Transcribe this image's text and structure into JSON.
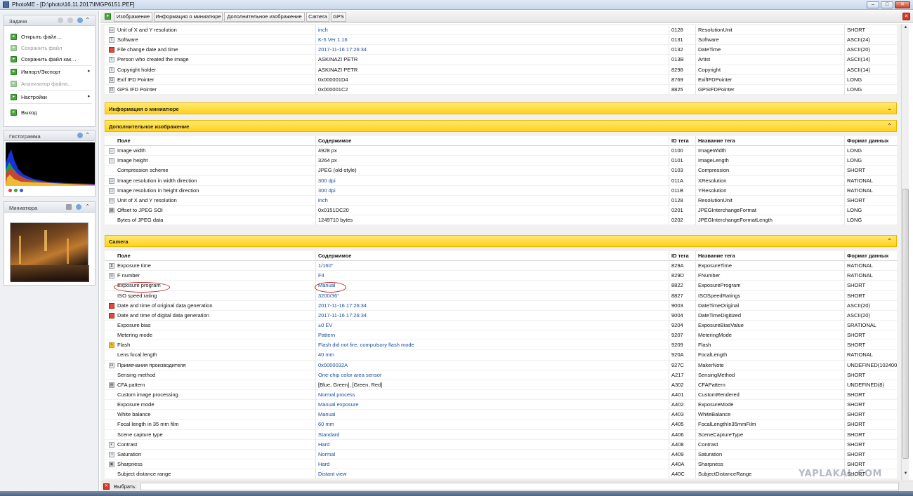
{
  "window": {
    "title": "PhotoME - [D:\\photo\\16.11.2017\\IMGP6151.PEF]",
    "controls": {
      "minimize": "–",
      "maximize": "□",
      "close": "✕"
    }
  },
  "sidebar": {
    "tasks": {
      "title": "Задачи",
      "items": [
        {
          "label": "Открыть файл…",
          "enabled": true
        },
        {
          "label": "Сохранить файл",
          "enabled": false
        },
        {
          "label": "Сохранить файл как…",
          "enabled": true
        },
        {
          "label": "Импорт/Экспорт",
          "enabled": true,
          "submenu": "▸"
        },
        {
          "label": "Анализатор файла…",
          "enabled": false
        },
        {
          "label": "Настройки",
          "enabled": true,
          "submenu": "▸"
        },
        {
          "label": "Выход",
          "enabled": true
        }
      ]
    },
    "histogram": {
      "title": "Гистограмма"
    },
    "thumbnail": {
      "title": "Миниатюра"
    },
    "collapse_glyph": "⌃"
  },
  "toolbar": {
    "tabs": [
      "Изображение",
      "Информация о миниатюре",
      "Дополнительное изображение",
      "Camera",
      "GPS"
    ]
  },
  "colors": {
    "accent_yellow": "#ffd21a",
    "link_blue": "#1a4fa0",
    "annotation_red": "#c81e1e"
  },
  "columns": [
    "Поле",
    "Содержимое",
    "ID тега",
    "Название тега",
    "Формат данных"
  ],
  "image_section_tail": [
    {
      "icon": "ruler-icon",
      "field": "Unit of X and Y resolution",
      "value": "inch",
      "link": true,
      "id": "0128",
      "tag": "ResolutionUnit",
      "format": "SHORT"
    },
    {
      "icon": "text-icon",
      "field": "Software",
      "value": "K-5 Ver 1.16",
      "link": true,
      "id": "0131",
      "tag": "Software",
      "format": "ASCII(24)"
    },
    {
      "icon": "calendar-icon",
      "field": "File change date and time",
      "value": "2017-11-16 17:26:34",
      "link": true,
      "id": "0132",
      "tag": "DateTime",
      "format": "ASCII(20)"
    },
    {
      "icon": "text-icon",
      "field": "Person who created the image",
      "value": "ASKINAZI PETR",
      "link": false,
      "id": "013B",
      "tag": "Artist",
      "format": "ASCII(14)"
    },
    {
      "icon": "text-icon",
      "field": "Copyright holder",
      "value": "ASKINAZI PETR",
      "link": false,
      "id": "8298",
      "tag": "Copyright",
      "format": "ASCII(14)"
    },
    {
      "icon": "camera-icon",
      "field": "Exif IFD Pointer",
      "value": "0x000001D4",
      "link": false,
      "id": "8769",
      "tag": "ExifIFDPointer",
      "format": "LONG"
    },
    {
      "icon": "camera-icon",
      "field": "GPS IFD Pointer",
      "value": "0x000001C2",
      "link": false,
      "id": "8825",
      "tag": "GPSIFDPointer",
      "format": "LONG"
    }
  ],
  "sections": {
    "thumbnail_info": {
      "title": "Информация о миниатюре",
      "chevron": "⌄"
    },
    "extra_image": {
      "title": "Дополнительное изображение",
      "chevron": "⌃"
    },
    "camera": {
      "title": "Camera",
      "chevron": "⌃"
    }
  },
  "extra_image_rows": [
    {
      "icon": "width-icon",
      "field": "Image width",
      "value": "4928 px",
      "link": false,
      "id": "0100",
      "tag": "ImageWidth",
      "format": "LONG"
    },
    {
      "icon": "height-icon",
      "field": "Image height",
      "value": "3264 px",
      "link": false,
      "id": "0101",
      "tag": "ImageLength",
      "format": "LONG"
    },
    {
      "icon": "",
      "field": "Compression scheme",
      "value": "JPEG (old-style)",
      "link": false,
      "id": "0103",
      "tag": "Compression",
      "format": "SHORT"
    },
    {
      "icon": "ruler-icon",
      "field": "Image resolution in width direction",
      "value": "300 dpi",
      "link": true,
      "id": "011A",
      "tag": "XResolution",
      "format": "RATIONAL"
    },
    {
      "icon": "ruler-icon",
      "field": "Image resolution in height direction",
      "value": "300 dpi",
      "link": true,
      "id": "011B",
      "tag": "YResolution",
      "format": "RATIONAL"
    },
    {
      "icon": "ruler-icon",
      "field": "Unit of X and Y resolution",
      "value": "inch",
      "link": true,
      "id": "0128",
      "tag": "ResolutionUnit",
      "format": "SHORT"
    },
    {
      "icon": "image-icon",
      "field": "Offset to JPEG SOI",
      "value": "0x0151DC20",
      "link": false,
      "id": "0201",
      "tag": "JPEGInterchangeFormat",
      "format": "LONG"
    },
    {
      "icon": "",
      "field": "Bytes of JPEG data",
      "value": "1249710 bytes",
      "link": false,
      "id": "0202",
      "tag": "JPEGInterchangeFormatLength",
      "format": "LONG"
    }
  ],
  "camera_rows": [
    {
      "icon": "hourglass-icon",
      "field": "Exposure time",
      "value": "1/160\"",
      "link": true,
      "id": "829A",
      "tag": "ExposureTime",
      "format": "RATIONAL"
    },
    {
      "icon": "aperture-icon",
      "field": "F number",
      "value": "F4",
      "link": true,
      "id": "829D",
      "tag": "FNumber",
      "format": "RATIONAL"
    },
    {
      "icon": "",
      "field": "Exposure program",
      "value": "Manual",
      "link": true,
      "id": "8822",
      "tag": "ExposureProgram",
      "format": "SHORT"
    },
    {
      "icon": "",
      "field": "ISO speed rating",
      "value": "3200/36°",
      "link": true,
      "id": "8827",
      "tag": "ISOSpeedRatings",
      "format": "SHORT"
    },
    {
      "icon": "calendar-icon",
      "field": "Date and time of original data generation",
      "value": "2017-11-16 17:26:34",
      "link": true,
      "id": "9003",
      "tag": "DateTimeOriginal",
      "format": "ASCII(20)"
    },
    {
      "icon": "calendar-icon",
      "field": "Date and time of digital data generation",
      "value": "2017-11-16 17:26:34",
      "link": true,
      "id": "9004",
      "tag": "DateTimeDigitized",
      "format": "ASCII(20)"
    },
    {
      "icon": "",
      "field": "Exposure bias",
      "value": "±0 EV",
      "link": true,
      "id": "9204",
      "tag": "ExposureBiasValue",
      "format": "SRATIONAL"
    },
    {
      "icon": "",
      "field": "Metering mode",
      "value": "Pattern",
      "link": true,
      "id": "9207",
      "tag": "MeteringMode",
      "format": "SHORT"
    },
    {
      "icon": "flash-icon",
      "field": "Flash",
      "value": "Flash did not fire, compulsory flash mode",
      "link": true,
      "id": "9209",
      "tag": "Flash",
      "format": "SHORT"
    },
    {
      "icon": "",
      "field": "Lens focal length",
      "value": "40 mm",
      "link": true,
      "id": "920A",
      "tag": "FocalLength",
      "format": "RATIONAL"
    },
    {
      "icon": "camera-icon",
      "field": "Примечания производителя",
      "value": "0x0000032A",
      "link": true,
      "id": "927C",
      "tag": "MakerNote",
      "format": "UNDEFINED(102400"
    },
    {
      "icon": "",
      "field": "Sensing method",
      "value": "One-chip color area sensor",
      "link": true,
      "id": "A217",
      "tag": "SensingMethod",
      "format": "SHORT"
    },
    {
      "icon": "grid-icon",
      "field": "CFA pattern",
      "value": "[Blue, Green], [Green, Red]",
      "link": false,
      "id": "A302",
      "tag": "CFAPattern",
      "format": "UNDEFINED(8)"
    },
    {
      "icon": "",
      "field": "Custom image processing",
      "value": "Normal process",
      "link": true,
      "id": "A401",
      "tag": "CustomRendered",
      "format": "SHORT"
    },
    {
      "icon": "",
      "field": "Exposure mode",
      "value": "Manual exposure",
      "link": true,
      "id": "A402",
      "tag": "ExposureMode",
      "format": "SHORT"
    },
    {
      "icon": "",
      "field": "White balance",
      "value": "Manual",
      "link": true,
      "id": "A403",
      "tag": "WhiteBalance",
      "format": "SHORT"
    },
    {
      "icon": "",
      "field": "Focal length in 35 mm film",
      "value": "60 mm",
      "link": true,
      "id": "A405",
      "tag": "FocalLengthIn35mmFilm",
      "format": "SHORT"
    },
    {
      "icon": "",
      "field": "Scene capture type",
      "value": "Standard",
      "link": true,
      "id": "A406",
      "tag": "SceneCaptureType",
      "format": "SHORT"
    },
    {
      "icon": "contrast-icon",
      "field": "Contrast",
      "value": "Hard",
      "link": true,
      "id": "A408",
      "tag": "Contrast",
      "format": "SHORT"
    },
    {
      "icon": "saturation-icon",
      "field": "Saturation",
      "value": "Normal",
      "link": true,
      "id": "A409",
      "tag": "Saturation",
      "format": "SHORT"
    },
    {
      "icon": "sharpness-icon",
      "field": "Sharpness",
      "value": "Hard",
      "link": true,
      "id": "A40A",
      "tag": "Sharpness",
      "format": "SHORT"
    },
    {
      "icon": "",
      "field": "Subject distance range",
      "value": "Distant view",
      "link": true,
      "id": "A40C",
      "tag": "SubjectDistanceRange",
      "format": "SHORT"
    }
  ],
  "statusbar": {
    "label": "Выбрать:"
  },
  "watermark": "YAPLAKAL.COM"
}
